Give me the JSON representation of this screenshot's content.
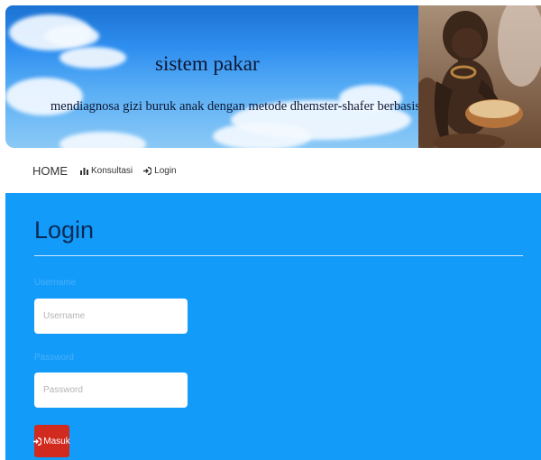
{
  "header": {
    "title": "sistem pakar",
    "subtitle": "mendiagnosa gizi buruk anak dengan metode dhemster-shafer berbasis web"
  },
  "nav": {
    "home": "HOME",
    "konsultasi": "Konsultasi",
    "login": "Login",
    "icons": {
      "konsultasi": "bar-chart-icon",
      "login": "login-icon"
    }
  },
  "login": {
    "title": "Login",
    "username_label": "Username",
    "username_placeholder": "Username",
    "password_label": "Password",
    "password_placeholder": "Password",
    "submit_label": "Masuk",
    "submit_icon": "login-icon"
  },
  "colors": {
    "panel_background": "#139bfa",
    "submit_button": "#d12a1f",
    "title_text": "#0a2a55"
  }
}
